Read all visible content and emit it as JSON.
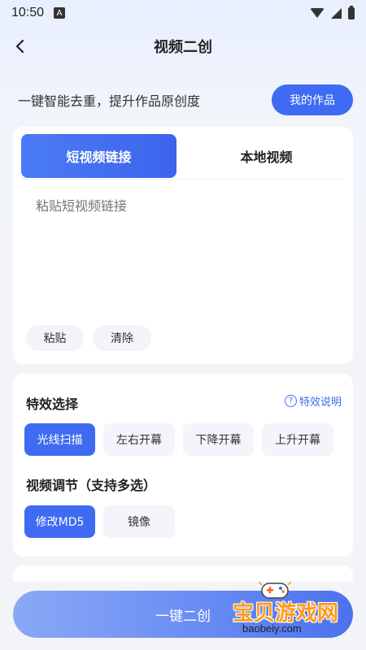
{
  "status_bar": {
    "time": "10:50",
    "notification_icon": "A"
  },
  "nav": {
    "title": "视频二创",
    "back_icon": "chevron-left-icon"
  },
  "intro": {
    "text": "一键智能去重，提升作品原创度",
    "my_works_label": "我的作品"
  },
  "link_card": {
    "tabs": [
      {
        "label": "短视频链接",
        "active": true
      },
      {
        "label": "本地视频",
        "active": false
      }
    ],
    "input_placeholder": "粘贴短视频链接",
    "input_value": "",
    "paste_label": "粘贴",
    "clear_label": "清除"
  },
  "effects": {
    "title": "特效选择",
    "help_label": "特效说明",
    "options": [
      {
        "label": "光线扫描",
        "selected": true
      },
      {
        "label": "左右开幕",
        "selected": false
      },
      {
        "label": "下降开幕",
        "selected": false
      },
      {
        "label": "上升开幕",
        "selected": false
      }
    ]
  },
  "adjust": {
    "title": "视频调节（支持多选）",
    "options": [
      {
        "label": "修改MD5",
        "selected": true
      },
      {
        "label": "镜像",
        "selected": false
      }
    ]
  },
  "action": {
    "label": "一键二创"
  },
  "watermark": {
    "text": "宝贝游戏网",
    "url": "baobeiy.com"
  },
  "colors": {
    "accent": "#3f6bf2",
    "background": "#f3f4f8",
    "watermark": "#ff9a1a"
  }
}
